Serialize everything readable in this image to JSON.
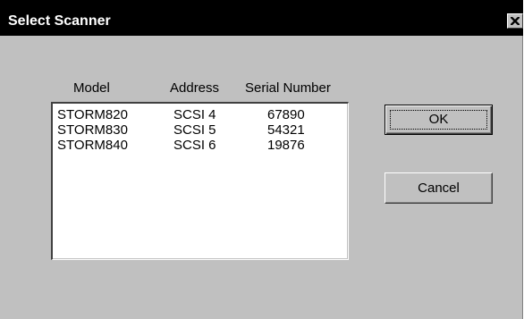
{
  "window": {
    "title": "Select Scanner",
    "close_icon": "close-x-icon"
  },
  "table": {
    "columns": [
      "Model",
      "Address",
      "Serial Number"
    ],
    "rows": [
      {
        "model": "STORM820",
        "address": "SCSI 4",
        "serial": "67890"
      },
      {
        "model": "STORM830",
        "address": "SCSI 5",
        "serial": "54321"
      },
      {
        "model": "STORM840",
        "address": "SCSI 6",
        "serial": "19876"
      }
    ]
  },
  "buttons": {
    "ok_label": "OK",
    "cancel_label": "Cancel"
  },
  "colors": {
    "titlebar": "#000000",
    "face": "#c0c0c0",
    "list_background": "#ffffff"
  }
}
